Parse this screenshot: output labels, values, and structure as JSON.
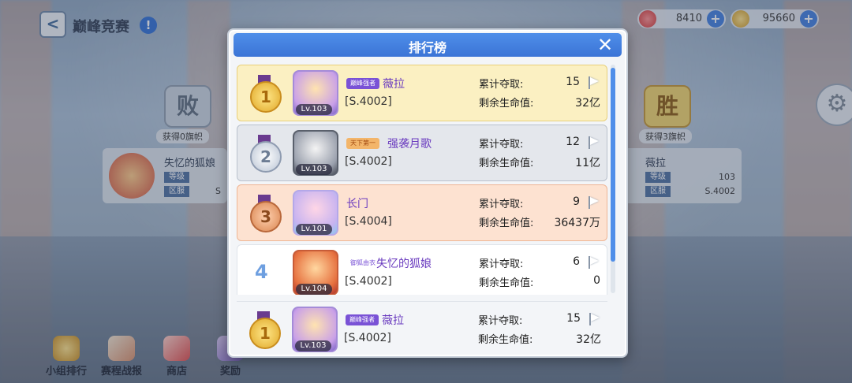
{
  "header": {
    "back_label": "<",
    "title": "巅峰竞赛",
    "info_label": "!",
    "resources": [
      {
        "icon": "red-gem-icon",
        "value": "8410",
        "plus": "+"
      },
      {
        "icon": "gold-coin-icon",
        "value": "95660",
        "plus": "+"
      }
    ]
  },
  "background": {
    "left_team": {
      "badge": "败",
      "caption": "获得0旗帜",
      "name": "失忆的狐娘",
      "level_tag": "等级",
      "server_tag": "区服",
      "server": "S"
    },
    "right_team": {
      "badge": "胜",
      "caption": "获得3旗帜",
      "name": "薇拉",
      "level_tag": "等级",
      "level": "103",
      "server_tag": "区服",
      "server": "S.4002"
    }
  },
  "bottom_nav": [
    {
      "label": "小组排行"
    },
    {
      "label": "赛程战报"
    },
    {
      "label": "商店"
    },
    {
      "label": "奖励"
    }
  ],
  "modal": {
    "title": "排行榜",
    "close": "✕",
    "rows": [
      {
        "rank": "1",
        "title_tag": "巅峰强者",
        "name": "薇拉",
        "level": "Lv.103",
        "server": "[S.4002]",
        "label1": "累计夺取:",
        "captured": "15",
        "label2": "剩余生命值:",
        "hp": "32亿"
      },
      {
        "rank": "2",
        "title_tag": "天下第一",
        "name": "强袭月歌",
        "level": "Lv.103",
        "server": "[S.4002]",
        "label1": "累计夺取:",
        "captured": "12",
        "label2": "剩余生命值:",
        "hp": "11亿"
      },
      {
        "rank": "3",
        "title_tag": "",
        "name": "长门",
        "level": "Lv.101",
        "server": "[S.4004]",
        "label1": "累计夺取:",
        "captured": "9",
        "label2": "剩余生命值:",
        "hp": "36437万"
      },
      {
        "rank": "4",
        "title_tag": "御狐由衣",
        "name": "失忆的狐娘",
        "level": "Lv.104",
        "server": "[S.4002]",
        "label1": "累计夺取:",
        "captured": "6",
        "label2": "剩余生命值:",
        "hp": "0"
      }
    ],
    "mine": {
      "rank": "1",
      "title_tag": "巅峰强者",
      "name": "薇拉",
      "level": "Lv.103",
      "server": "[S.4002]",
      "label1": "累计夺取:",
      "captured": "15",
      "label2": "剩余生命值:",
      "hp": "32亿"
    }
  }
}
